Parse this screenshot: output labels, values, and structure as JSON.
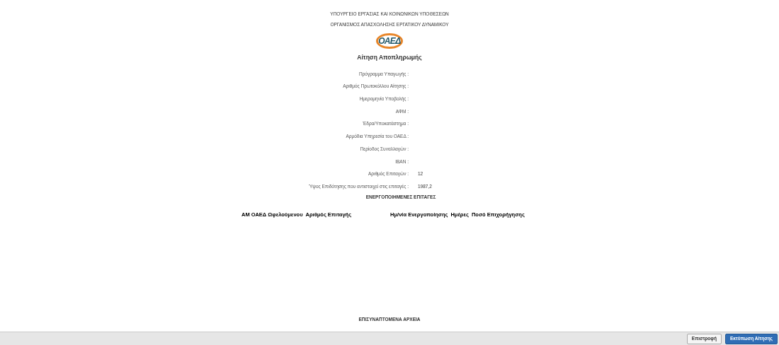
{
  "header": {
    "ministry": "ΥΠΟΥΡΓΕΙΟ ΕΡΓΑΣΙΑΣ ΚΑΙ ΚΟΙΝΩΝΙΚΩΝ ΥΠΟΘΕΣΕΩΝ",
    "organization": "ΟΡΓΑΝΙΣΜΟΣ ΑΠΑΣΧΟΛΗΣΗΣ ΕΡΓΑΤΙΚΟΥ ΔΥΝΑΜΙΚΟΥ",
    "logo_text": "ΟΑΕΔ",
    "title": "Αίτηση Αποπληρωμής"
  },
  "fields": [
    {
      "label": "Πρόγραμμα Υπαγωγής :"
    },
    {
      "label": "Αριθμός Πρωτοκόλλου Αίτησης :"
    },
    {
      "label": "Ημερομηνία Υποβολής :"
    },
    {
      "label": "ΑΦΜ :"
    },
    {
      "label": "Έδρα/Υποκατάστημα :"
    },
    {
      "label": "Αρμόδια Υπηρεσία του ΟΑΕΔ :"
    },
    {
      "label": "Περίοδος Συναλλαγών :"
    },
    {
      "label": "IBAN :"
    },
    {
      "label": "Αριθμός Επιταγών :",
      "value": "12"
    },
    {
      "label": "Ύψος Επιδότησης που αντιστοιχεί στις επιταγές :",
      "value": "1987,2"
    }
  ],
  "vouchers": {
    "title": "ΕΝΕΡΓΟΠΟΙΗΜΕΝΕΣ ΕΠΙΤΑΓΕΣ",
    "columns": [
      "ΑΜ ΟΑΕΔ Ωφελούμενου",
      "Αριθμός Επιταγής",
      "Ημ/νία Ενεργοποίησης",
      "Ημέρες",
      "Ποσό Επιχορήγησης"
    ]
  },
  "attachments": {
    "title": "ΕΠΙΣΥΝΑΠΤΟΜΕΝΑ ΑΡΧΕΙΑ"
  },
  "buttons": [
    {
      "label": "Επιστροφή",
      "kind": "secondary"
    },
    {
      "label": "Εκτύπωση Αίτησης",
      "kind": "primary"
    }
  ]
}
